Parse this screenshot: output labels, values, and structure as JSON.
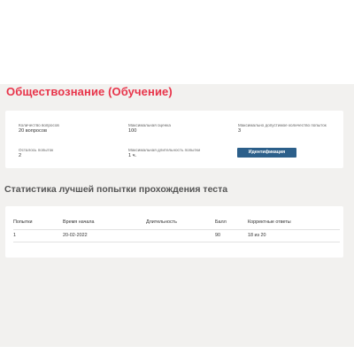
{
  "course": {
    "title": "Обществознание (Обучение)"
  },
  "info": {
    "question_count_label": "Количество вопросов",
    "question_count_value": "20 вопросов",
    "max_score_label": "Максимальная оценка",
    "max_score_value": "100",
    "max_attempts_label": "Максимально допустимое количество попыток",
    "max_attempts_value": "3",
    "attempts_left_label": "Осталось попыток",
    "attempts_left_value": "2",
    "max_duration_label": "Максимальная длительность попытки",
    "max_duration_value": "1 ч.",
    "identify_button_label": "Идентификация"
  },
  "stats": {
    "title": "Статистика лучшей попытки прохождения теста",
    "columns": [
      "Попытки",
      "Время начала",
      "Длительность",
      "Балл",
      "Корректные ответы"
    ],
    "rows": [
      [
        "1",
        "20-02-2022",
        "",
        "90",
        "18 из 20"
      ]
    ]
  },
  "colors": {
    "title_accent": "#e8344a",
    "button_bg": "#2c5f8a",
    "page_bg": "#f2f1ef"
  }
}
